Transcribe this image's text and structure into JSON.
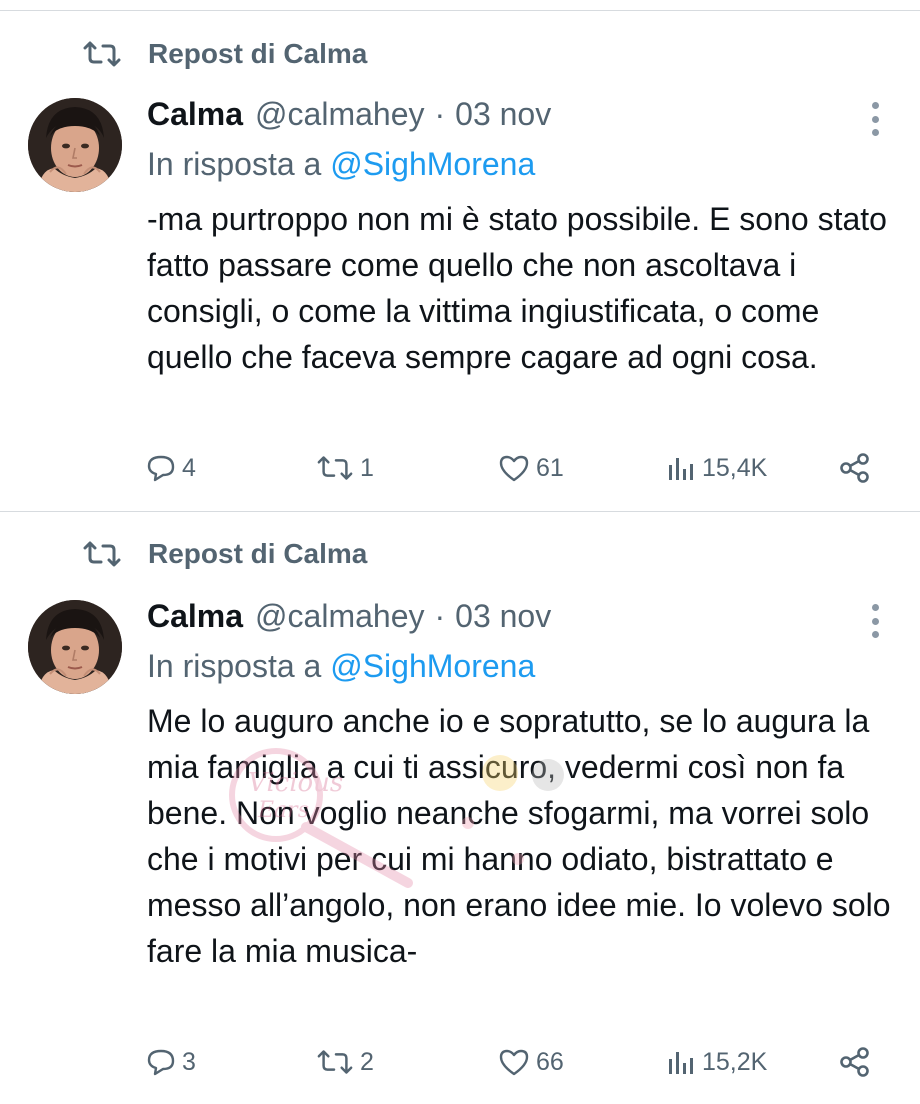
{
  "tweets": [
    {
      "repost_label": "Repost di Calma",
      "display_name": "Calma",
      "handle": "@calmahey",
      "separator": "·",
      "date": "03 nov",
      "reply_prefix": "In risposta a",
      "reply_mention": "@SighMorena",
      "text": "-ma purtroppo non mi è stato possibile. E sono stato fatto passare come quello che non ascoltava i consigli, o come la vittima ingiustificata, o come quello che faceva sempre cagare ad ogni cosa.",
      "replies": "4",
      "reposts": "1",
      "likes": "61",
      "views": "15,4K"
    },
    {
      "repost_label": "Repost di Calma",
      "display_name": "Calma",
      "handle": "@calmahey",
      "separator": "·",
      "date": "03 nov",
      "reply_prefix": "In risposta a",
      "reply_mention": "@SighMorena",
      "text": "Me lo auguro anche io e sopratutto, se lo augura la mia famiglia a cui ti assicuro, vedermi così non fa bene. Non voglio neanche sfogarmi, ma vorrei solo che i motivi per cui mi hanno odiato, bistrattato e messo all’angolo, non erano idee mie. Io volevo solo fare la mia musica-",
      "replies": "3",
      "reposts": "2",
      "likes": "66",
      "views": "15,2K"
    }
  ],
  "watermark_text": "Vicious Ears",
  "colors": {
    "text_primary": "#0f1419",
    "text_secondary": "#536471",
    "link": "#1d9bf0",
    "divider": "#d7dbdf"
  },
  "icons": [
    "repost-icon",
    "avatar",
    "more-icon",
    "reply-icon",
    "like-icon",
    "views-icon",
    "share-icon"
  ]
}
